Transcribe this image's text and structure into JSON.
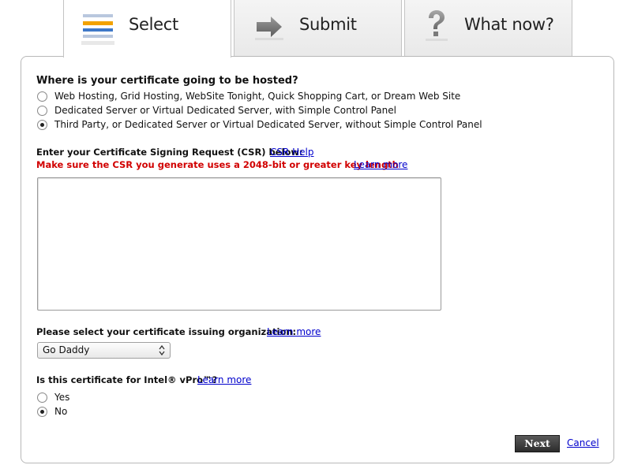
{
  "tabs": [
    {
      "label": "Select",
      "icon": "list-icon",
      "active": true
    },
    {
      "label": "Submit",
      "icon": "arrow-right-icon",
      "active": false
    },
    {
      "label": "What now?",
      "icon": "question-icon",
      "active": false
    }
  ],
  "hosting": {
    "question": "Where is your certificate going to be hosted?",
    "options": [
      {
        "label": "Web Hosting, Grid Hosting, WebSite Tonight, Quick Shopping Cart, or Dream Web Site",
        "checked": false
      },
      {
        "label": "Dedicated Server or Virtual Dedicated Server, with Simple Control Panel",
        "checked": false
      },
      {
        "label": "Third Party, or Dedicated Server or Virtual Dedicated Server, without Simple Control Panel",
        "checked": true
      }
    ]
  },
  "csr": {
    "label": "Enter your Certificate Signing Request (CSR) below:",
    "help_link": "CSR Help",
    "warning": "Make sure the CSR you generate uses a 2048-bit or greater key length",
    "learn_more": "Learn more",
    "value": ""
  },
  "issuer": {
    "label": "Please select your certificate issuing organization:",
    "learn_more": "Learn more",
    "selected": "Go Daddy"
  },
  "vpro": {
    "question": "Is this certificate for Intel® vPro™?",
    "learn_more": "Learn more",
    "options": [
      {
        "label": "Yes",
        "checked": false
      },
      {
        "label": "No",
        "checked": true
      }
    ]
  },
  "actions": {
    "next_label": "Next",
    "cancel_label": "Cancel"
  },
  "colors": {
    "warning": "#d10000",
    "link": "#0000cc",
    "icon_orange": "#f2a200",
    "icon_blue": "#3e78c8"
  }
}
